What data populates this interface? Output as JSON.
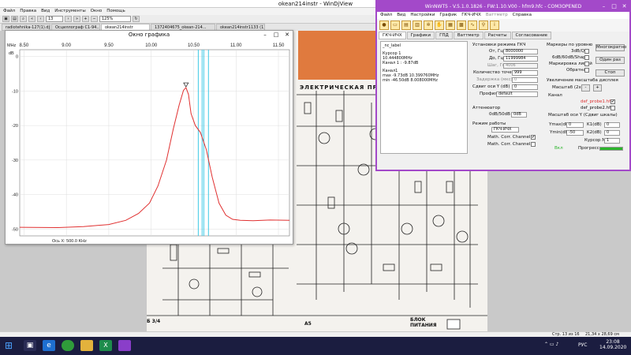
{
  "djview": {
    "title": "okean214instr - WinDjView",
    "menu": [
      "Файл",
      "Правка",
      "Вид",
      "Инструменты",
      "Окно",
      "Помощь"
    ],
    "page_field": "13",
    "zoom_field": "125%",
    "tabs": [
      "radiotehnika-127(1).djvu",
      "Осциллограф С1-94...",
      "okean214instr",
      "1372404675_okean-214...",
      "okean214instr1133 (1)"
    ],
    "active_tab": 2,
    "status_page": "Стр. 13 из 16",
    "status_size": "21,34 x 28,69 см"
  },
  "doc": {
    "heading": "ЭЛЕКТРИЧЕСКАЯ ПР",
    "label_bottom": "БЛОК ПИТАНИЯ",
    "label_a5": "А5",
    "label_b3": "Б 3/4"
  },
  "graph_window": {
    "title": "Окно графика",
    "unit_top": "MHz",
    "unit_left": "dB",
    "x_axis_label": "Ось X: 500.0 KHz"
  },
  "chart_data": {
    "type": "line",
    "xlabel": "",
    "ylabel": "dB",
    "x_ticks": [
      "8.50",
      "9.00",
      "9.50",
      "10.00",
      "10.50",
      "11.00",
      "11.50"
    ],
    "y_ticks": [
      "0",
      "-10",
      "-20",
      "-30",
      "-40",
      "-50"
    ],
    "xlim": [
      8.45,
      11.63
    ],
    "ylim": [
      -52,
      2
    ],
    "markers": [
      10.555,
      10.6,
      10.62,
      10.675
    ],
    "series": [
      {
        "x": [
          8.45,
          8.9,
          9.2,
          9.5,
          9.7,
          9.85,
          9.98,
          10.08,
          10.18,
          10.26,
          10.33,
          10.38,
          10.41,
          10.44,
          10.47,
          10.52,
          10.58,
          10.65,
          10.72,
          10.8,
          10.88,
          10.96,
          11.05,
          11.2,
          11.4,
          11.63
        ],
        "y": [
          -49.5,
          -49.6,
          -49.3,
          -48.7,
          -47.5,
          -45.5,
          -42.5,
          -37.5,
          -30,
          -21,
          -14,
          -9.8,
          -9,
          -11,
          -16.5,
          -20,
          -22,
          -27,
          -35,
          -42.5,
          -46,
          -47.2,
          -47.5,
          -47.6,
          -47.4,
          -47.5
        ]
      }
    ],
    "grid": true,
    "line_color": "#e03030",
    "marker_color": "#3ec9e6"
  },
  "winnwt": {
    "title": "WinNWT5 - V.5.1.0.1826 - FW:1.10.V00 - hfm9.hfc - COM3OPENED",
    "menu": [
      "Файл",
      "Вид",
      "Настройки",
      "График",
      "ГКЧ-ИЧХ",
      "Ваттметр",
      "Справка"
    ],
    "tabs": [
      "ГКЧ-ИЧХ",
      "Графики",
      "ГПД",
      "Ваттметр",
      "Расчеты",
      "Согласование"
    ],
    "active_tab": 0,
    "info": {
      "label": "_nc_label",
      "cursor": "Курсор 1",
      "freq": "10.444800MHz",
      "ch1": "Канал 1 : -9.87dB",
      "ch_head": "Канал1",
      "max": "max -9.73dB 10.399760MHz",
      "min": "min -46.50dB 8.008000MHz"
    },
    "setup": {
      "title": "Установки режима ГКЧ",
      "from_label": "От, Гц",
      "from_value": "8000000",
      "to_label": "До, Гц",
      "to_value": "11999984",
      "step_label": "Шаг, Гц",
      "step_value": "4006",
      "points_label": "Количество точек",
      "points_value": "999",
      "delay_label": "Задержка (мкс)",
      "delay_value": "0",
      "shift_label": "Сдвиг оси Y (dB)",
      "shift_value": "0",
      "profile_label": "Профиль",
      "profile_value": "default"
    },
    "atten": {
      "title": "Аттенюатор",
      "value": "0dB/50dB",
      "value2": "0dB"
    },
    "mode": {
      "title": "Режим работы",
      "value": "ГКЧ-ИЧХ",
      "corr1": "Math. Corr. Channel1",
      "corr2": "Math. Corr. Channel2"
    },
    "markers": {
      "title": "Маркеры по уровню",
      "m1": "3dB/Q",
      "m2": "6dB/60dB/Shape",
      "m3": "Маркировка линий",
      "m4": "Обратная"
    },
    "buttons": {
      "multi": "Многократно",
      "once": "Один раз",
      "stop": "Стоп"
    },
    "zoom": {
      "title": "Увеличение масштаба дисплея",
      "label": "Масштаб (2x)",
      "minus": "-",
      "plus": "+"
    },
    "channel": {
      "title": "Канал",
      "probe1": "def_probe1.hfm",
      "probe2": "def_probe2.hfm"
    },
    "scale": {
      "title": "Масштаб оси Y (Сдвиг шкалы)",
      "ymax_label": "Ymax(dB)",
      "ymax_value": "0",
      "ymin_label": "Ymin(dB)",
      "ymin_value": "-50",
      "k1_label": "K1(dB)",
      "k1_value": "0",
      "k2_label": "K2(dB)",
      "k2_value": "0",
      "cursor_label": "Курсор №",
      "cursor_value": "1"
    },
    "progress": {
      "on_label": "Вкл",
      "label": "Прогресс",
      "value": 1.0,
      "color": "#2bb52b"
    }
  },
  "taskbar": {
    "time": "23:08",
    "date": "14.09.2020",
    "lang": "РУС"
  }
}
